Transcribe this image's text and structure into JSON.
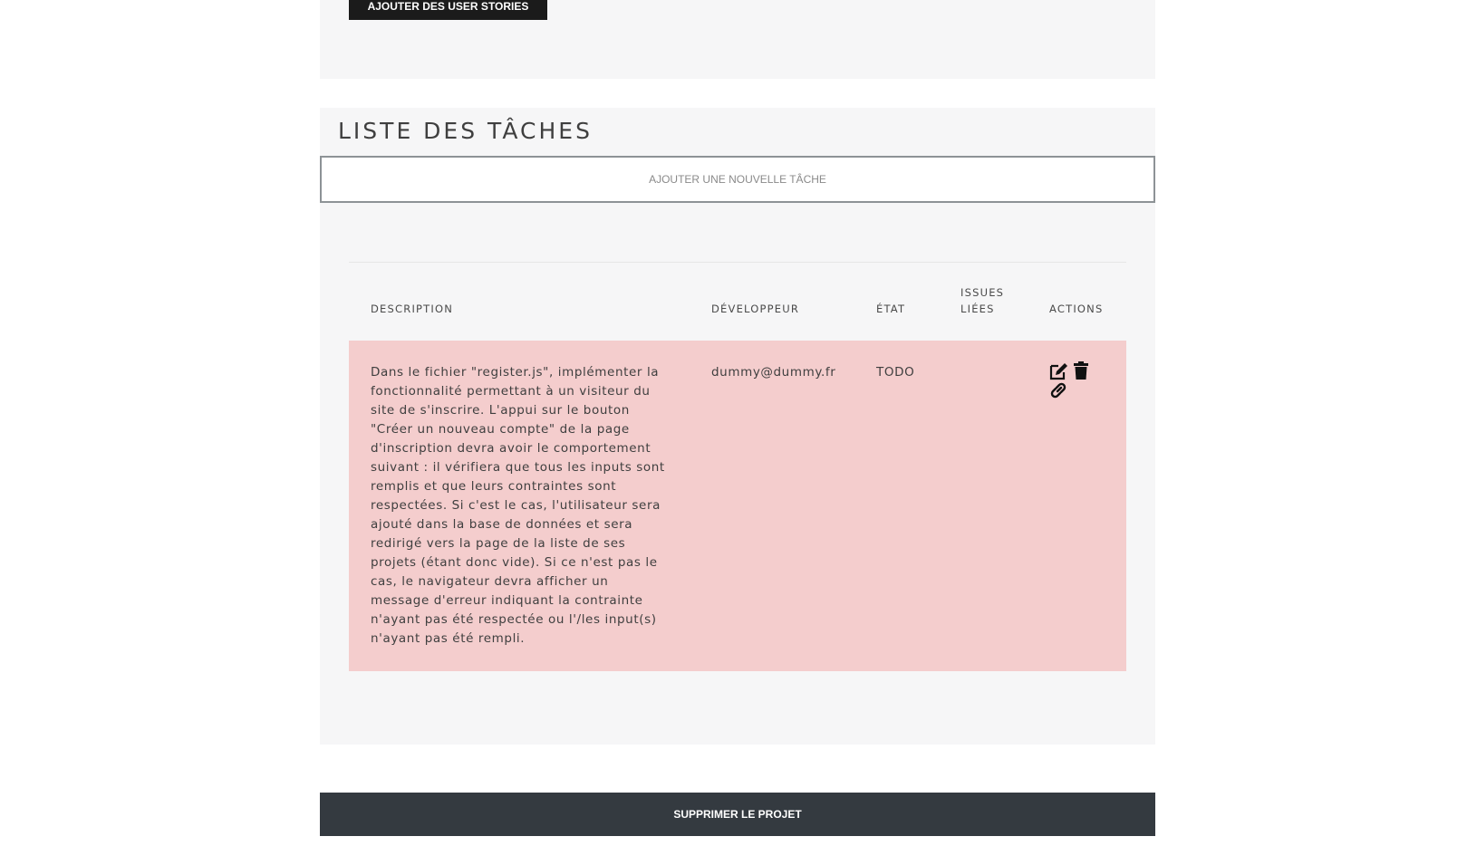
{
  "user_stories": {
    "add_button_label": "AJOUTER DES USER STORIES"
  },
  "tasks": {
    "title": "LISTE DES TÂCHES",
    "add_button_label": "AJOUTER UNE NOUVELLE TÂCHE",
    "columns": {
      "description": "DESCRIPTION",
      "developer": "DÉVELOPPEUR",
      "state": "ÉTAT",
      "linked_issues": "ISSUES LIÉES",
      "actions": "ACTIONS"
    },
    "rows": [
      {
        "description": "Dans le fichier \"register.js\", implémenter la fonctionnalité permettant à un visiteur du site de s'inscrire. L'appui sur le bouton \"Créer un nouveau compte\" de la page d'inscription devra avoir le comportement suivant : il vérifiera que tous les inputs sont remplis et que leurs contraintes sont respectées. Si c'est le cas, l'utilisateur sera ajouté dans la base de données et sera redirigé vers la page de la liste de ses projets (étant donc vide). Si ce n'est pas le cas, le navigateur devra afficher un message d'erreur indiquant la contrainte n'ayant pas été respectée ou l'/les input(s) n'ayant pas été rempli.",
        "developer": "dummy@dummy.fr",
        "state": "TODO",
        "linked_issues": "",
        "actions": [
          "edit-icon",
          "trash-icon",
          "link-icon"
        ],
        "row_color": "#f4cdcd"
      }
    ]
  },
  "footer": {
    "delete_project_label": "SUPPRIMER LE PROJET"
  },
  "colors": {
    "panel_background": "#f6f6f7",
    "dark_button": "#1b1b1b",
    "delete_button": "#343a40",
    "todo_row": "#f4cdcd"
  }
}
